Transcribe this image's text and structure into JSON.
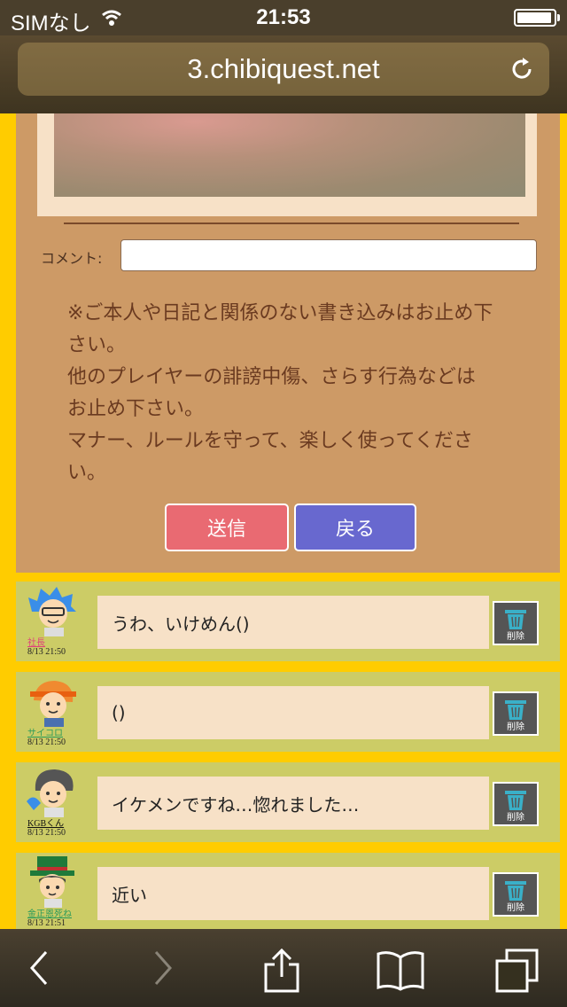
{
  "status_bar": {
    "carrier": "SIMなし",
    "time": "21:53"
  },
  "browser": {
    "url": "3.chibiquest.net"
  },
  "form": {
    "comment_label": "コメント:",
    "comment_value": "",
    "notice_lines": [
      "※ご本人や日記と関係のない書き込みはお止め下",
      "さい。",
      "他のプレイヤーの誹謗中傷、さらす行為などは",
      "お止め下さい。",
      "マナー、ルールを守って、楽しく使ってくださ",
      "い。"
    ],
    "send_label": "送信",
    "back_label": "戻る"
  },
  "comments": [
    {
      "author": "社長",
      "author_color": "#e0407a",
      "time": "8/13 21:50",
      "text": "うわ、いけめん()",
      "delete_label": "削除"
    },
    {
      "author": "サイコロ",
      "author_color": "#2a9a5a",
      "time": "8/13 21:50",
      "text": "()",
      "delete_label": "削除"
    },
    {
      "author": "KGBくん",
      "author_color": "#111111",
      "time": "8/13 21:50",
      "text": "イケメンですね…惚れました…",
      "delete_label": "削除"
    },
    {
      "author": "金正恩死ね",
      "author_color": "#2a9a5a",
      "time": "8/13 21:51",
      "text": "近い",
      "delete_label": "削除"
    }
  ],
  "colors": {
    "page_background": "#ffcc00",
    "panel": "#cd9a66",
    "comment_row": "#cccc66",
    "send_button": "#e96a72",
    "back_button": "#6868cf"
  }
}
